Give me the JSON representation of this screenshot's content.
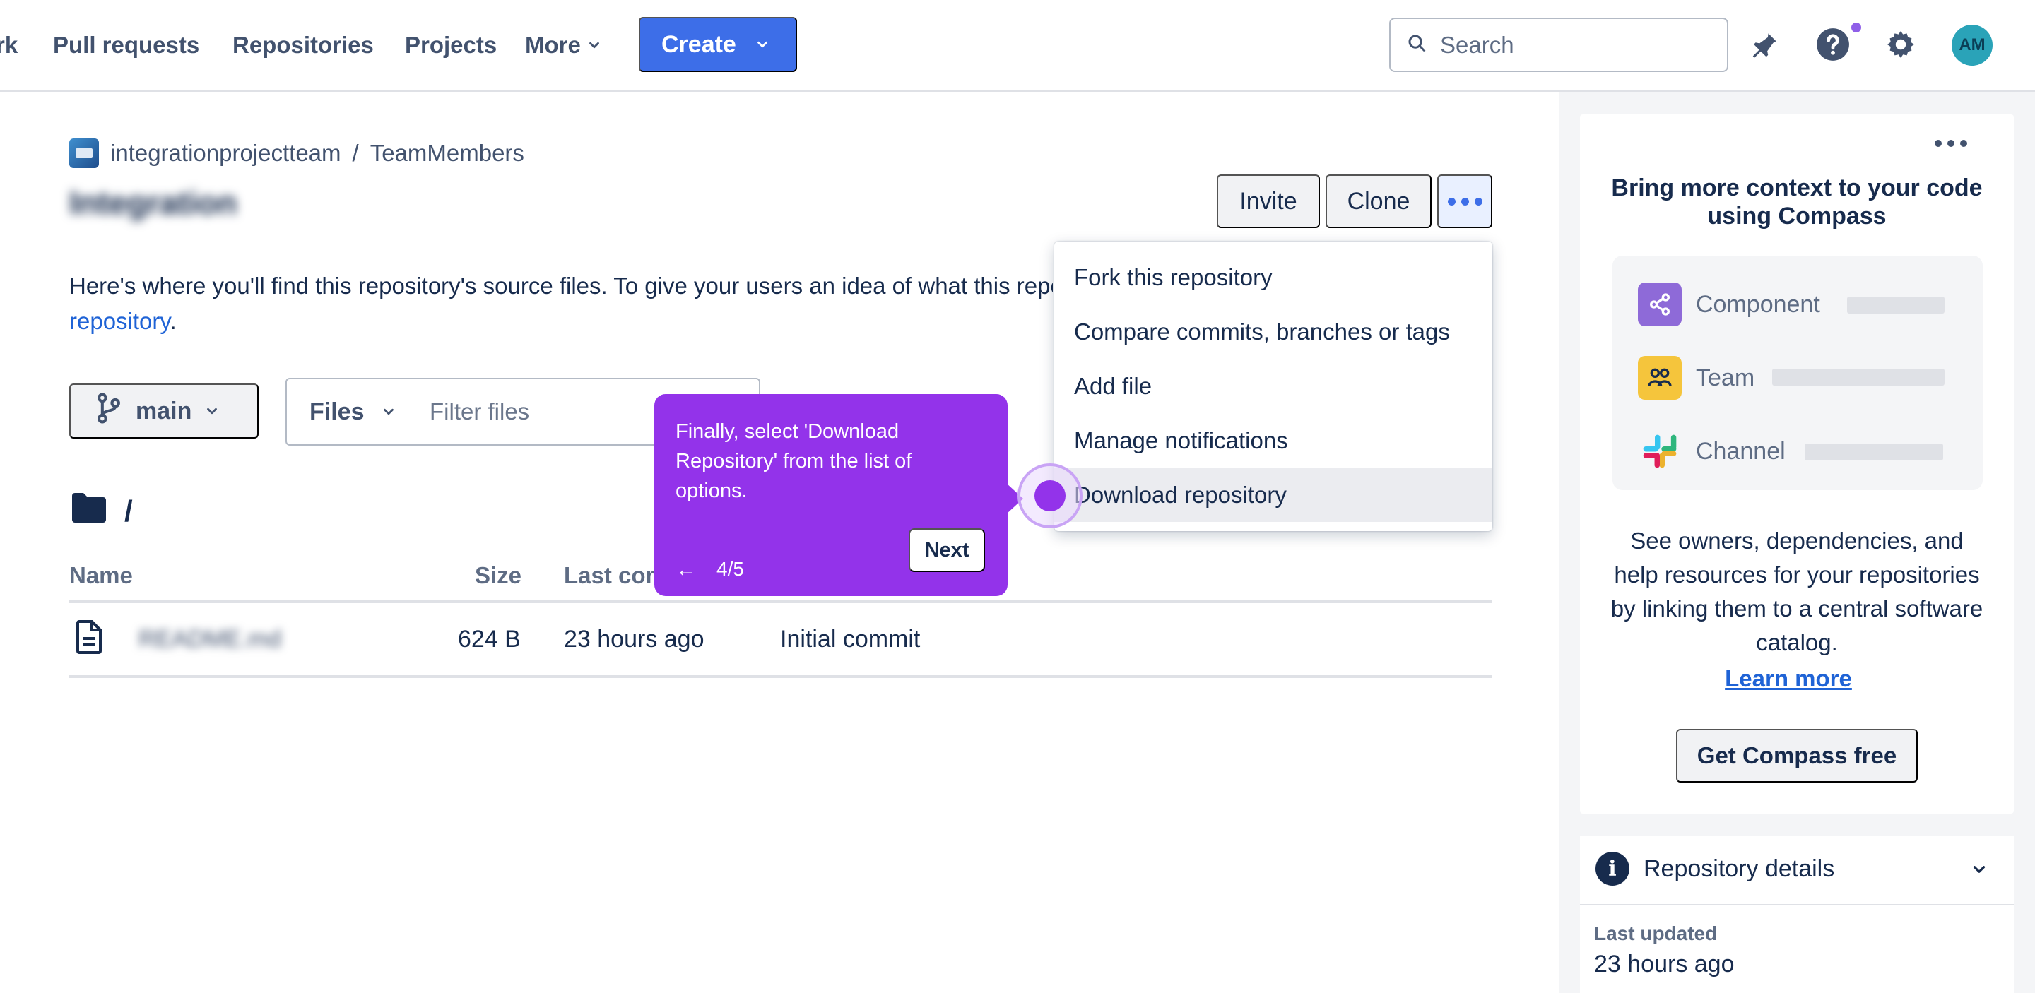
{
  "nav": {
    "items": [
      "rk",
      "Pull requests",
      "Repositories",
      "Projects"
    ],
    "more_label": "More",
    "create_label": "Create",
    "search_placeholder": "Search",
    "avatar_initials": "AM"
  },
  "breadcrumb": {
    "workspace": "integrationprojectteam",
    "separator": "/",
    "project": "TeamMembers"
  },
  "repo": {
    "title": "Integration",
    "invite_label": "Invite",
    "clone_label": "Clone",
    "intro_text": "Here's where you'll find this repository's source files. To give your users an idea of what this repository contains,",
    "intro_link": "repository",
    "intro_tail": "."
  },
  "toolbar": {
    "branch": "main",
    "files_label": "Files",
    "filter_placeholder": "Filter files"
  },
  "folder": {
    "path": "/"
  },
  "table": {
    "headers": {
      "name": "Name",
      "size": "Size",
      "last_commit": "Last commit"
    },
    "rows": [
      {
        "name": "README.md",
        "size": "624 B",
        "time": "23 hours ago",
        "message": "Initial commit"
      }
    ]
  },
  "dropdown": {
    "items": [
      "Fork this repository",
      "Compare commits, branches or tags",
      "Add file",
      "Manage notifications",
      "Download repository"
    ]
  },
  "tooltip": {
    "text": "Finally, select 'Download Repository' from the list of options.",
    "back": "←",
    "step": "4/5",
    "next_label": "Next"
  },
  "compass": {
    "title": "Bring more context to your code using Compass",
    "rows": [
      "Component",
      "Team",
      "Channel"
    ],
    "description": "See owners, dependencies, and help resources for your repositories by linking them to a central software catalog.",
    "learn_more": "Learn more",
    "cta": "Get Compass free"
  },
  "details": {
    "title": "Repository details",
    "last_updated_label": "Last updated",
    "last_updated_value": "23 hours ago"
  },
  "colors": {
    "accent": "#3d6ee8",
    "tooltip": "#9333ea",
    "link": "#1f63d6"
  }
}
